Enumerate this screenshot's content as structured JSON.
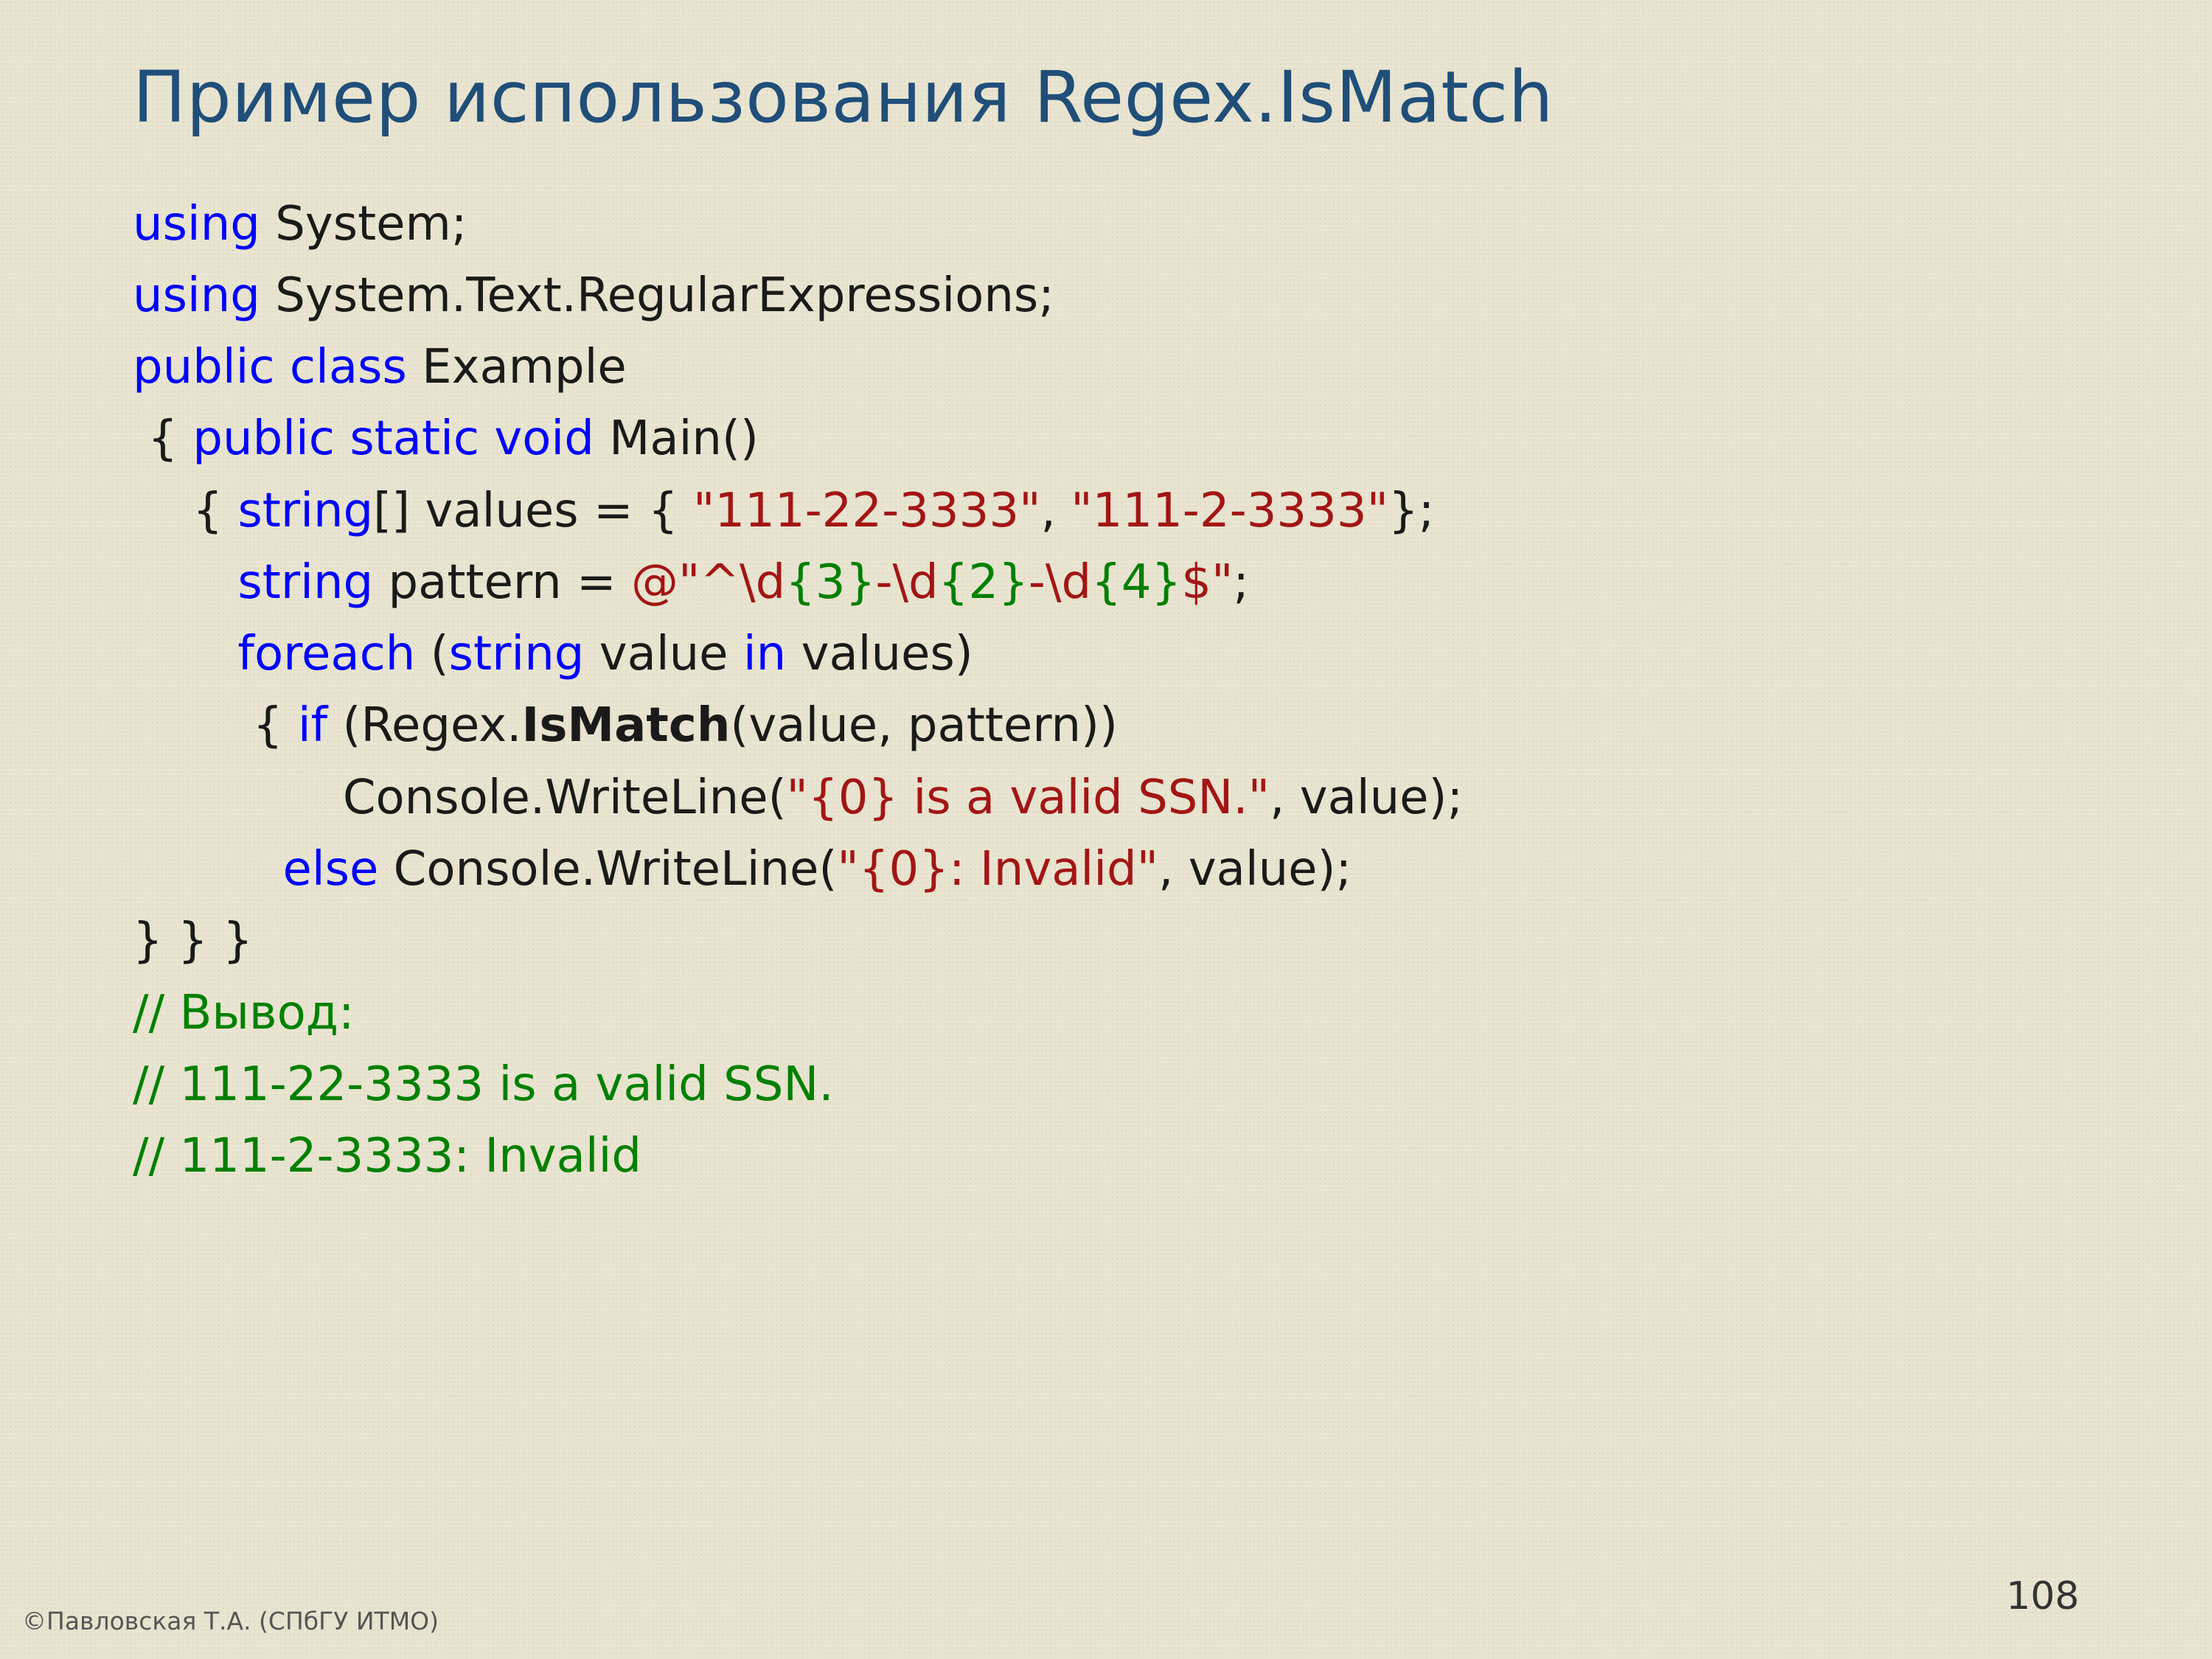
{
  "slide": {
    "title": "Пример использования Regex.IsMatch",
    "footer": "©Павловская Т.А. (СПбГУ ИТМО)",
    "page_number": "108"
  },
  "code": {
    "l1": {
      "kw": "using",
      "rest": " System;"
    },
    "l2": {
      "kw": "using",
      "rest": " System.Text.RegularExpressions;"
    },
    "l3": {
      "kw": "public class",
      "rest": " Example"
    },
    "l4": {
      "pre": " { ",
      "kw": "public static void",
      "rest": " Main()"
    },
    "l5": {
      "pre": "    { ",
      "kw": "string",
      "mid1": "[] values = { ",
      "s1": "\"111-22-3333\"",
      "mid2": ", ",
      "s2": "\"111-2-3333\"",
      "end": "};"
    },
    "l6": {
      "pre": "       ",
      "kw": "string",
      "mid1": " pattern = ",
      "at": "@\"",
      "r1": "^\\d",
      "g1": "{3}",
      "r2": "-\\d",
      "g2": "{2}",
      "r3": "-\\d",
      "g3": "{4}",
      "r4": "$\"",
      "end": ";"
    },
    "l7": {
      "pre": "       ",
      "kw1": "foreach",
      "mid1": " (",
      "kw2": "string",
      "mid2": " value ",
      "kw3": "in",
      "end": " values)"
    },
    "l8": {
      "pre": "        { ",
      "kw": "if",
      "mid1": " (Regex.",
      "bold": "IsMatch",
      "end": "(value, pattern))"
    },
    "l9": {
      "pre": "              Console.WriteLine(",
      "s": "\"{0} is a valid SSN.\"",
      "end": ", value);"
    },
    "l10": {
      "pre": "          ",
      "kw": "else",
      "mid": " Console.WriteLine(",
      "s": "\"{0}: Invalid\"",
      "end": ", value);"
    },
    "l11": "} } }",
    "l12": "// Вывод:",
    "l13": "// 111-22-3333 is a valid SSN.",
    "l14": "// 111-2-3333: Invalid"
  }
}
